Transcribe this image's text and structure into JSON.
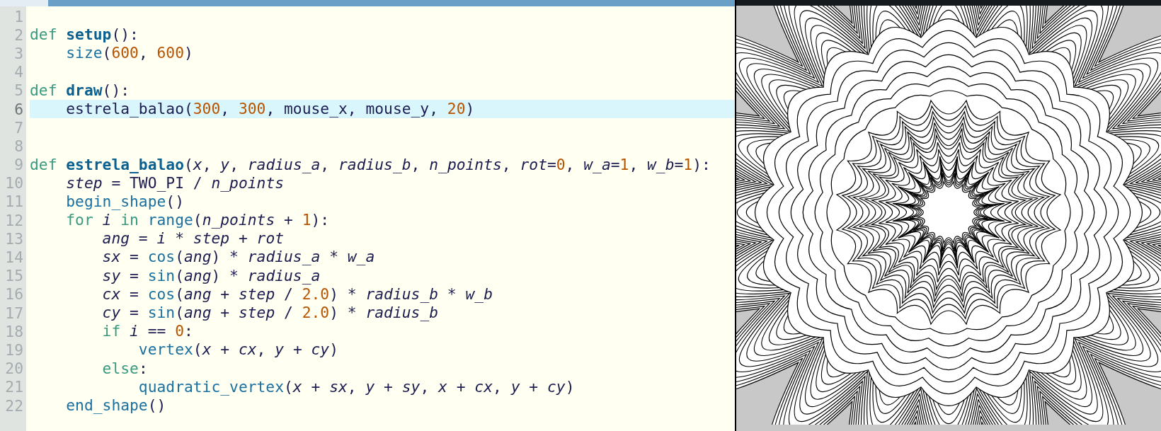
{
  "editor": {
    "lines": [
      {
        "number": "1",
        "selected": false
      },
      {
        "number": "2",
        "selected": false,
        "tokens": [
          {
            "kind": "kw",
            "text": "def"
          },
          {
            "kind": "defname",
            "text": " setup"
          },
          {
            "kind": "plain",
            "text": "():"
          }
        ]
      },
      {
        "number": "3",
        "selected": false,
        "tokens": [
          {
            "kind": "builtin",
            "text": "    size"
          },
          {
            "kind": "plain",
            "text": "("
          },
          {
            "kind": "num",
            "text": "600"
          },
          {
            "kind": "plain",
            "text": ", "
          },
          {
            "kind": "num",
            "text": "600"
          },
          {
            "kind": "plain",
            "text": ")"
          }
        ]
      },
      {
        "number": "4",
        "selected": false
      },
      {
        "number": "5",
        "selected": false,
        "tokens": [
          {
            "kind": "kw",
            "text": "def"
          },
          {
            "kind": "defname",
            "text": " draw"
          },
          {
            "kind": "plain",
            "text": "():"
          }
        ]
      },
      {
        "number": "6",
        "selected": true,
        "tokens": [
          {
            "kind": "plain",
            "text": "    estrela_balao("
          },
          {
            "kind": "num",
            "text": "300"
          },
          {
            "kind": "plain",
            "text": ", "
          },
          {
            "kind": "num",
            "text": "300"
          },
          {
            "kind": "plain",
            "text": ", mouse_x, mouse_y, "
          },
          {
            "kind": "num",
            "text": "20"
          },
          {
            "kind": "plain",
            "text": ")"
          }
        ]
      },
      {
        "number": "7",
        "selected": false
      },
      {
        "number": "8",
        "selected": false
      },
      {
        "number": "9",
        "selected": false,
        "tokens": [
          {
            "kind": "kw",
            "text": "def"
          },
          {
            "kind": "defname",
            "text": " estrela_balao"
          },
          {
            "kind": "plain",
            "text": "("
          },
          {
            "kind": "var",
            "text": "x"
          },
          {
            "kind": "plain",
            "text": ", "
          },
          {
            "kind": "var",
            "text": "y"
          },
          {
            "kind": "plain",
            "text": ", "
          },
          {
            "kind": "var",
            "text": "radius_a"
          },
          {
            "kind": "plain",
            "text": ", "
          },
          {
            "kind": "var",
            "text": "radius_b"
          },
          {
            "kind": "plain",
            "text": ", "
          },
          {
            "kind": "var",
            "text": "n_points"
          },
          {
            "kind": "plain",
            "text": ", "
          },
          {
            "kind": "var",
            "text": "rot"
          },
          {
            "kind": "plain",
            "text": "="
          },
          {
            "kind": "num",
            "text": "0"
          },
          {
            "kind": "plain",
            "text": ", "
          },
          {
            "kind": "var",
            "text": "w_a"
          },
          {
            "kind": "plain",
            "text": "="
          },
          {
            "kind": "num",
            "text": "1"
          },
          {
            "kind": "plain",
            "text": ", "
          },
          {
            "kind": "var",
            "text": "w_b"
          },
          {
            "kind": "plain",
            "text": "="
          },
          {
            "kind": "num",
            "text": "1"
          },
          {
            "kind": "plain",
            "text": "):"
          }
        ]
      },
      {
        "number": "10",
        "selected": false,
        "tokens": [
          {
            "kind": "var",
            "text": "    step"
          },
          {
            "kind": "plain",
            "text": " = TWO_PI / "
          },
          {
            "kind": "var",
            "text": "n_points"
          }
        ]
      },
      {
        "number": "11",
        "selected": false,
        "tokens": [
          {
            "kind": "builtin",
            "text": "    begin_shape"
          },
          {
            "kind": "plain",
            "text": "()"
          }
        ]
      },
      {
        "number": "12",
        "selected": false,
        "tokens": [
          {
            "kind": "kw",
            "text": "    for"
          },
          {
            "kind": "var",
            "text": " i"
          },
          {
            "kind": "kw",
            "text": " in"
          },
          {
            "kind": "builtin",
            "text": " range"
          },
          {
            "kind": "plain",
            "text": "("
          },
          {
            "kind": "var",
            "text": "n_points"
          },
          {
            "kind": "plain",
            "text": " + "
          },
          {
            "kind": "num",
            "text": "1"
          },
          {
            "kind": "plain",
            "text": "):"
          }
        ]
      },
      {
        "number": "13",
        "selected": false,
        "tokens": [
          {
            "kind": "var",
            "text": "        ang"
          },
          {
            "kind": "plain",
            "text": " = "
          },
          {
            "kind": "var",
            "text": "i"
          },
          {
            "kind": "plain",
            "text": " * "
          },
          {
            "kind": "var",
            "text": "step"
          },
          {
            "kind": "plain",
            "text": " + "
          },
          {
            "kind": "var",
            "text": "rot"
          }
        ]
      },
      {
        "number": "14",
        "selected": false,
        "tokens": [
          {
            "kind": "var",
            "text": "        sx"
          },
          {
            "kind": "plain",
            "text": " = "
          },
          {
            "kind": "builtin",
            "text": "cos"
          },
          {
            "kind": "plain",
            "text": "("
          },
          {
            "kind": "var",
            "text": "ang"
          },
          {
            "kind": "plain",
            "text": ") * "
          },
          {
            "kind": "var",
            "text": "radius_a"
          },
          {
            "kind": "plain",
            "text": " * "
          },
          {
            "kind": "var",
            "text": "w_a"
          }
        ]
      },
      {
        "number": "15",
        "selected": false,
        "tokens": [
          {
            "kind": "var",
            "text": "        sy"
          },
          {
            "kind": "plain",
            "text": " = "
          },
          {
            "kind": "builtin",
            "text": "sin"
          },
          {
            "kind": "plain",
            "text": "("
          },
          {
            "kind": "var",
            "text": "ang"
          },
          {
            "kind": "plain",
            "text": ") * "
          },
          {
            "kind": "var",
            "text": "radius_a"
          }
        ]
      },
      {
        "number": "16",
        "selected": false,
        "tokens": [
          {
            "kind": "var",
            "text": "        cx"
          },
          {
            "kind": "plain",
            "text": " = "
          },
          {
            "kind": "builtin",
            "text": "cos"
          },
          {
            "kind": "plain",
            "text": "("
          },
          {
            "kind": "var",
            "text": "ang"
          },
          {
            "kind": "plain",
            "text": " + "
          },
          {
            "kind": "var",
            "text": "step"
          },
          {
            "kind": "plain",
            "text": " / "
          },
          {
            "kind": "num",
            "text": "2.0"
          },
          {
            "kind": "plain",
            "text": ") * "
          },
          {
            "kind": "var",
            "text": "radius_b"
          },
          {
            "kind": "plain",
            "text": " * "
          },
          {
            "kind": "var",
            "text": "w_b"
          }
        ]
      },
      {
        "number": "17",
        "selected": false,
        "tokens": [
          {
            "kind": "var",
            "text": "        cy"
          },
          {
            "kind": "plain",
            "text": " = "
          },
          {
            "kind": "builtin",
            "text": "sin"
          },
          {
            "kind": "plain",
            "text": "("
          },
          {
            "kind": "var",
            "text": "ang"
          },
          {
            "kind": "plain",
            "text": " + "
          },
          {
            "kind": "var",
            "text": "step"
          },
          {
            "kind": "plain",
            "text": " / "
          },
          {
            "kind": "num",
            "text": "2.0"
          },
          {
            "kind": "plain",
            "text": ") * "
          },
          {
            "kind": "var",
            "text": "radius_b"
          }
        ]
      },
      {
        "number": "18",
        "selected": false,
        "tokens": [
          {
            "kind": "kw",
            "text": "        if"
          },
          {
            "kind": "var",
            "text": " i"
          },
          {
            "kind": "plain",
            "text": " == "
          },
          {
            "kind": "num",
            "text": "0"
          },
          {
            "kind": "plain",
            "text": ":"
          }
        ]
      },
      {
        "number": "19",
        "selected": false,
        "tokens": [
          {
            "kind": "builtin",
            "text": "            vertex"
          },
          {
            "kind": "plain",
            "text": "("
          },
          {
            "kind": "var",
            "text": "x"
          },
          {
            "kind": "plain",
            "text": " + "
          },
          {
            "kind": "var",
            "text": "cx"
          },
          {
            "kind": "plain",
            "text": ", "
          },
          {
            "kind": "var",
            "text": "y"
          },
          {
            "kind": "plain",
            "text": " + "
          },
          {
            "kind": "var",
            "text": "cy"
          },
          {
            "kind": "plain",
            "text": ")"
          }
        ]
      },
      {
        "number": "20",
        "selected": false,
        "tokens": [
          {
            "kind": "kw",
            "text": "        else"
          },
          {
            "kind": "plain",
            "text": ":"
          }
        ]
      },
      {
        "number": "21",
        "selected": false,
        "tokens": [
          {
            "kind": "builtin",
            "text": "            quadratic_vertex"
          },
          {
            "kind": "plain",
            "text": "("
          },
          {
            "kind": "var",
            "text": "x"
          },
          {
            "kind": "plain",
            "text": " + "
          },
          {
            "kind": "var",
            "text": "sx"
          },
          {
            "kind": "plain",
            "text": ", "
          },
          {
            "kind": "var",
            "text": "y"
          },
          {
            "kind": "plain",
            "text": " + "
          },
          {
            "kind": "var",
            "text": "sy"
          },
          {
            "kind": "plain",
            "text": ", "
          },
          {
            "kind": "var",
            "text": "x"
          },
          {
            "kind": "plain",
            "text": " + "
          },
          {
            "kind": "var",
            "text": "cx"
          },
          {
            "kind": "plain",
            "text": ", "
          },
          {
            "kind": "var",
            "text": "y"
          },
          {
            "kind": "plain",
            "text": " + "
          },
          {
            "kind": "var",
            "text": "cy"
          },
          {
            "kind": "plain",
            "text": ")"
          }
        ]
      },
      {
        "number": "22",
        "selected": false,
        "tokens": [
          {
            "kind": "builtin",
            "text": "    end_shape"
          },
          {
            "kind": "plain",
            "text": "()"
          }
        ]
      }
    ]
  }
}
